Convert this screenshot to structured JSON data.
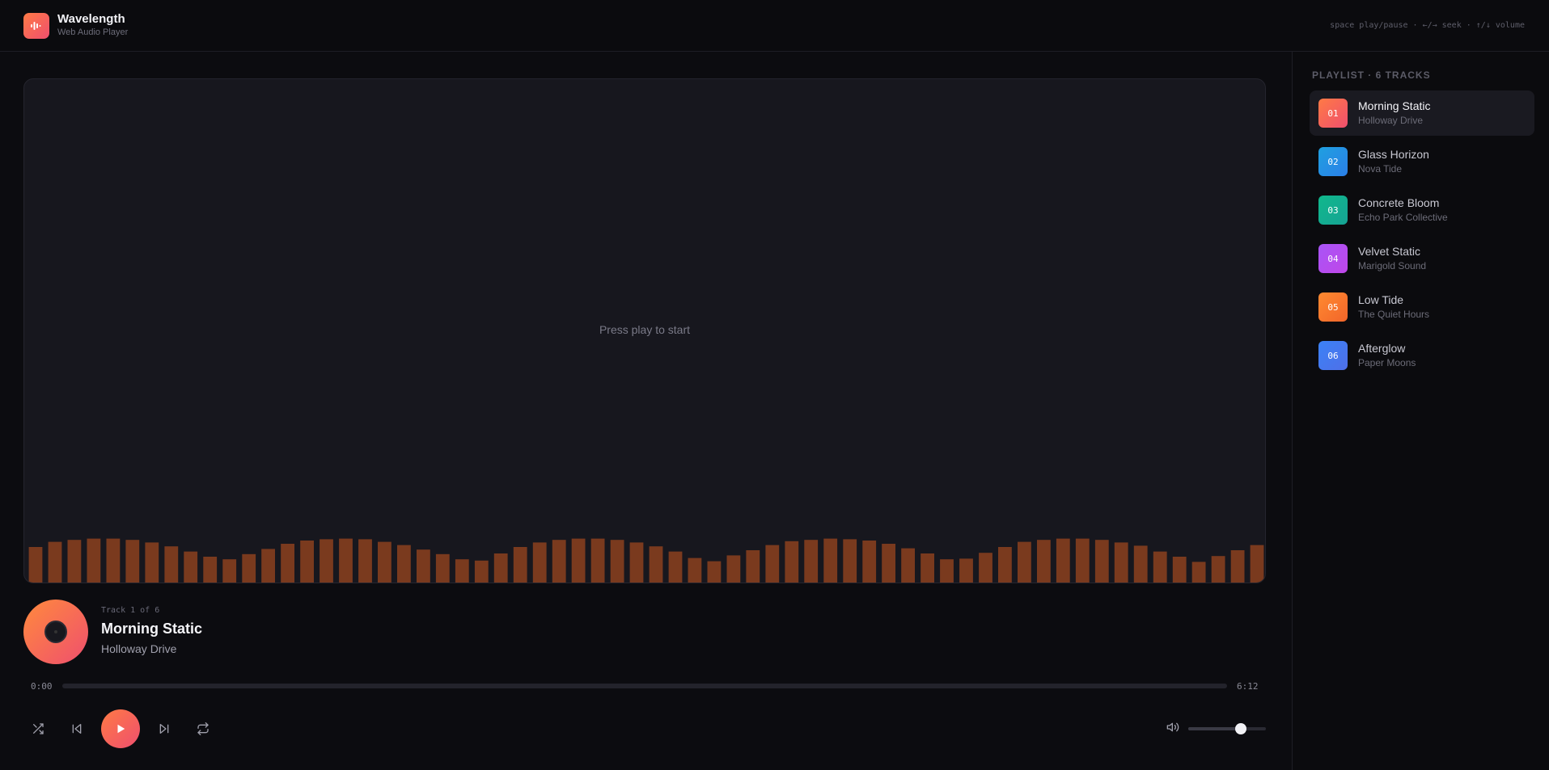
{
  "app": {
    "name": "Wavelength",
    "subtitle": "Web Audio Player",
    "shortcuts": "space play/pause · ←/→ seek · ↑/↓ volume"
  },
  "visualizer": {
    "message": "Press play to start",
    "bar_color": "#7a3a1e",
    "bar_levels": [
      0.55,
      0.63,
      0.66,
      0.68,
      0.68,
      0.66,
      0.62,
      0.56,
      0.48,
      0.4,
      0.36,
      0.44,
      0.52,
      0.6,
      0.65,
      0.67,
      0.68,
      0.67,
      0.63,
      0.58,
      0.51,
      0.44,
      0.36,
      0.34,
      0.45,
      0.55,
      0.62,
      0.66,
      0.68,
      0.68,
      0.66,
      0.62,
      0.56,
      0.48,
      0.38,
      0.33,
      0.42,
      0.5,
      0.58,
      0.64,
      0.66,
      0.68,
      0.67,
      0.65,
      0.6,
      0.53,
      0.45,
      0.36,
      0.37,
      0.46,
      0.55,
      0.63,
      0.66,
      0.68,
      0.68,
      0.66,
      0.62,
      0.57,
      0.48,
      0.4,
      0.32,
      0.41,
      0.5,
      0.58
    ]
  },
  "now_playing": {
    "track_index": "Track 1 of 6",
    "title": "Morning Static",
    "artist": "Holloway Drive",
    "disc_icon": "vinyl-disc-icon"
  },
  "progress": {
    "current": "0:00",
    "total": "6:12",
    "fraction": 0
  },
  "controls": {
    "shuffle_icon": "shuffle-icon",
    "prev_icon": "skip-back-icon",
    "play_icon": "play-icon",
    "next_icon": "skip-forward-icon",
    "repeat_icon": "repeat-icon",
    "volume_icon": "volume-icon",
    "volume": 0.68
  },
  "playlist": {
    "heading": "PLAYLIST · 6 TRACKS",
    "items": [
      {
        "num": "01",
        "title": "Morning Static",
        "artist": "Holloway Drive",
        "color_a": "#ff7a45",
        "color_b": "#ef4f6e"
      },
      {
        "num": "02",
        "title": "Glass Horizon",
        "artist": "Nova Tide",
        "color_a": "#1fa0e0",
        "color_b": "#2b7fe8"
      },
      {
        "num": "03",
        "title": "Concrete Bloom",
        "artist": "Echo Park Collective",
        "color_a": "#10b88c",
        "color_b": "#16a394"
      },
      {
        "num": "04",
        "title": "Velvet Static",
        "artist": "Marigold Sound",
        "color_a": "#a855f7",
        "color_b": "#c046e8"
      },
      {
        "num": "05",
        "title": "Low Tide",
        "artist": "The Quiet Hours",
        "color_a": "#ff8a30",
        "color_b": "#f2652a"
      },
      {
        "num": "06",
        "title": "Afterglow",
        "artist": "Paper Moons",
        "color_a": "#3b82f6",
        "color_b": "#4f6fe8"
      }
    ]
  }
}
